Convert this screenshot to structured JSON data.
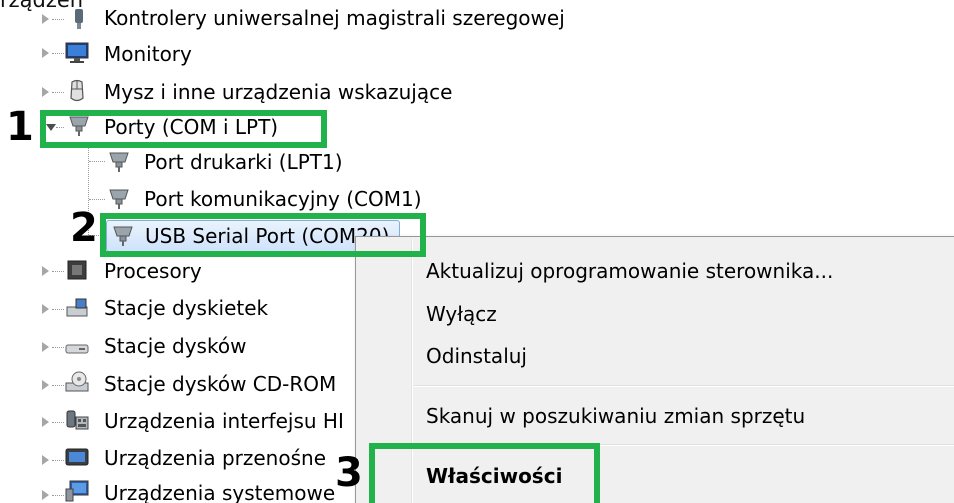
{
  "header_cut_text": "rządzeń",
  "tree": {
    "items": [
      {
        "label": "Kontrolery uniwersalnej magistrali szeregowej",
        "icon": "usb-controller-icon"
      },
      {
        "label": "Monitory",
        "icon": "monitor-icon"
      },
      {
        "label": "Mysz i inne urządzenia wskazujące",
        "icon": "mouse-icon"
      },
      {
        "label": "Porty (COM i LPT)",
        "icon": "port-icon"
      },
      {
        "label": "Port drukarki (LPT1)",
        "icon": "port-icon"
      },
      {
        "label": "Port komunikacyjny (COM1)",
        "icon": "port-icon"
      },
      {
        "label": "USB Serial Port (COM20)",
        "icon": "port-icon"
      },
      {
        "label": "Procesory",
        "icon": "processor-icon"
      },
      {
        "label": "Stacje dyskietek",
        "icon": "floppy-icon"
      },
      {
        "label": "Stacje dysków",
        "icon": "disk-drive-icon"
      },
      {
        "label": "Stacje dysków CD-ROM",
        "icon": "cdrom-icon"
      },
      {
        "label": "Urządzenia interfejsu HI",
        "icon": "hid-icon"
      },
      {
        "label": "Urządzenia przenośne",
        "icon": "portable-device-icon"
      },
      {
        "label": "Urządzenia systemowe",
        "icon": "system-device-icon"
      }
    ]
  },
  "context_menu": {
    "items": [
      {
        "label": "Aktualizuj oprogramowanie sterownika..."
      },
      {
        "label": "Wyłącz"
      },
      {
        "label": "Odinstaluj"
      },
      {
        "label": "Skanuj w poszukiwaniu zmian sprzętu"
      },
      {
        "label": "Właściwości"
      }
    ]
  },
  "annotations": {
    "step1": "1",
    "step2": "2",
    "step3": "3"
  },
  "colors": {
    "highlight_box": "#21b24b",
    "selection_border": "#84acdd",
    "menu_background": "#f0f0f0"
  }
}
